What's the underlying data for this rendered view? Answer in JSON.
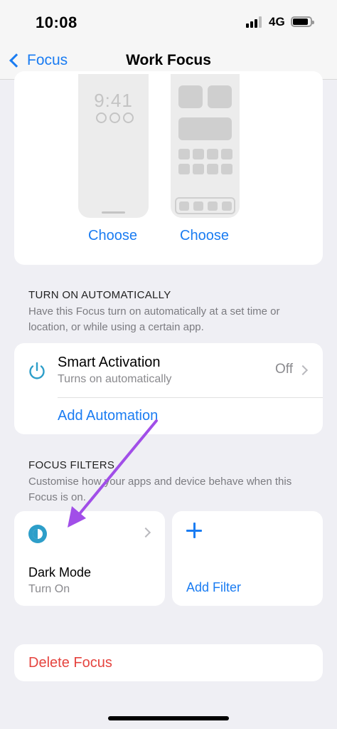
{
  "status_bar": {
    "time": "10:08",
    "network": "4G"
  },
  "nav": {
    "back_label": "Focus",
    "title": "Work Focus"
  },
  "customize": {
    "lock_screen_time": "9:41",
    "lock_choose_label": "Choose",
    "home_choose_label": "Choose"
  },
  "turn_on": {
    "header": "TURN ON AUTOMATICALLY",
    "description": "Have this Focus turn on automatically at a set time or location, or while using a certain app.",
    "smart_activation": {
      "title": "Smart Activation",
      "subtitle": "Turns on automatically",
      "value": "Off"
    },
    "add_automation_label": "Add Automation"
  },
  "focus_filters": {
    "header": "FOCUS FILTERS",
    "description": "Customise how your apps and device behave when this Focus is on.",
    "filters": [
      {
        "title": "Dark Mode",
        "subtitle": "Turn On",
        "icon": "dark-mode-icon"
      }
    ],
    "add_filter_label": "Add Filter"
  },
  "delete_label": "Delete Focus",
  "colors": {
    "accent": "#1a7cf2",
    "destructive": "#e5443f",
    "annotation_arrow": "#a14ee8",
    "dark_mode_icon": "#2d9ec9"
  }
}
